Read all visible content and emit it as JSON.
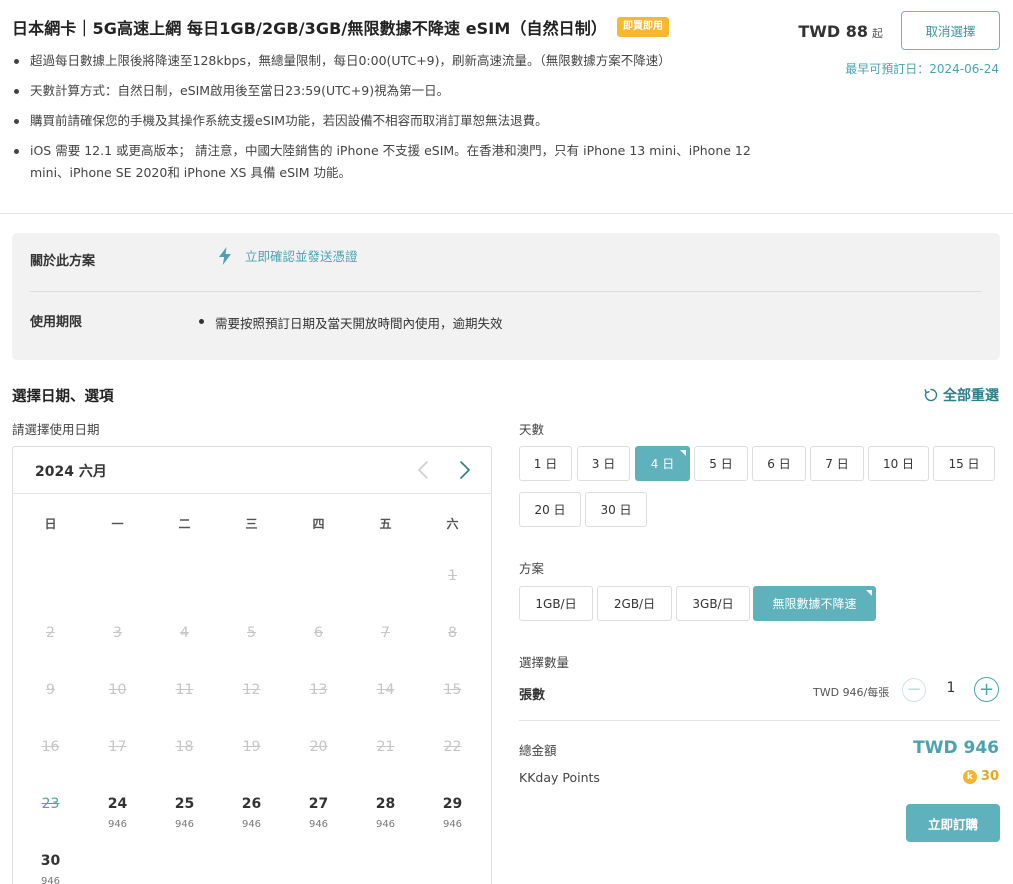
{
  "product": {
    "title": "日本網卡｜5G高速上網 每日1GB/2GB/3GB/無限數據不降速 eSIM（自然日制）",
    "badge": "即買即用",
    "bullets": [
      "超過每日數據上限後將降速至128kbps，無總量限制，每日0:00(UTC+9)，刷新高速流量。（無限數據方案不降速）",
      "天數計算方式：自然日制，eSIM啟用後至當日23:59(UTC+9)視為第一日。",
      "購買前請確保您的手機及其操作系統支援eSIM功能，若因設備不相容而取消訂單恕無法退費。",
      "iOS 需要 12.1 或更高版本； 請注意，中國大陸銷售的 iPhone 不支援 eSIM。在香港和澳門，只有 iPhone 13 mini、iPhone 12 mini、iPhone SE 2020和 iPhone XS 具備 eSIM 功能。"
    ],
    "price_from": "TWD 88",
    "price_suffix": "起",
    "cancel_label": "取消選擇",
    "earliest_date": "最早可預訂日：2024-06-24"
  },
  "about": {
    "label": "關於此方案",
    "confirm_text": "立即確認並發送憑證",
    "period_label": "使用期限",
    "period_item": "需要按照預訂日期及當天開放時間內使用，逾期失效"
  },
  "selection": {
    "title": "選擇日期、選項",
    "reset_label": "全部重選",
    "date_prompt": "請選擇使用日期"
  },
  "calendar": {
    "month_label": "2024 六月",
    "weekdays": [
      "日",
      "一",
      "二",
      "三",
      "四",
      "五",
      "六"
    ],
    "weeks": [
      [
        {
          "d": "",
          "s": "empty"
        },
        {
          "d": "",
          "s": "empty"
        },
        {
          "d": "",
          "s": "empty"
        },
        {
          "d": "",
          "s": "empty"
        },
        {
          "d": "",
          "s": "empty"
        },
        {
          "d": "",
          "s": "empty"
        },
        {
          "d": "1",
          "s": "disabled"
        }
      ],
      [
        {
          "d": "2",
          "s": "disabled"
        },
        {
          "d": "3",
          "s": "disabled"
        },
        {
          "d": "4",
          "s": "disabled"
        },
        {
          "d": "5",
          "s": "disabled"
        },
        {
          "d": "6",
          "s": "disabled"
        },
        {
          "d": "7",
          "s": "disabled"
        },
        {
          "d": "8",
          "s": "disabled"
        }
      ],
      [
        {
          "d": "9",
          "s": "disabled"
        },
        {
          "d": "10",
          "s": "disabled"
        },
        {
          "d": "11",
          "s": "disabled"
        },
        {
          "d": "12",
          "s": "disabled"
        },
        {
          "d": "13",
          "s": "disabled"
        },
        {
          "d": "14",
          "s": "disabled"
        },
        {
          "d": "15",
          "s": "disabled"
        }
      ],
      [
        {
          "d": "16",
          "s": "disabled"
        },
        {
          "d": "17",
          "s": "disabled"
        },
        {
          "d": "18",
          "s": "disabled"
        },
        {
          "d": "19",
          "s": "disabled"
        },
        {
          "d": "20",
          "s": "disabled"
        },
        {
          "d": "21",
          "s": "disabled"
        },
        {
          "d": "22",
          "s": "disabled"
        }
      ],
      [
        {
          "d": "23",
          "s": "today"
        },
        {
          "d": "24",
          "s": "avail",
          "p": "946"
        },
        {
          "d": "25",
          "s": "avail",
          "p": "946"
        },
        {
          "d": "26",
          "s": "avail",
          "p": "946"
        },
        {
          "d": "27",
          "s": "avail",
          "p": "946"
        },
        {
          "d": "28",
          "s": "avail",
          "p": "946"
        },
        {
          "d": "29",
          "s": "avail",
          "p": "946"
        }
      ],
      [
        {
          "d": "30",
          "s": "avail",
          "p": "946"
        }
      ]
    ]
  },
  "days": {
    "label": "天數",
    "options": [
      "1 日",
      "3 日",
      "4 日",
      "5 日",
      "6 日",
      "7 日",
      "10 日",
      "15 日",
      "20 日",
      "30 日"
    ],
    "selected": "4 日"
  },
  "plan": {
    "label": "方案",
    "options": [
      "1GB/日",
      "2GB/日",
      "3GB/日",
      "無限數據不降速"
    ],
    "selected": "無限數據不降速"
  },
  "quantity": {
    "section_label": "選擇數量",
    "label": "張數",
    "unit_price": "TWD 946/每張",
    "value": "1",
    "minus_symbol": "−",
    "plus_symbol": "+"
  },
  "total": {
    "label": "總金額",
    "value": "TWD 946",
    "points_label": "KKday Points",
    "points_icon_letter": "k",
    "points_value": "30",
    "order_label": "立即訂購"
  },
  "colors": {
    "accent": "#4aa3b0",
    "selected_chip": "#5fb1bc",
    "badge": "#f5b82e",
    "points": "#e7a81f"
  }
}
